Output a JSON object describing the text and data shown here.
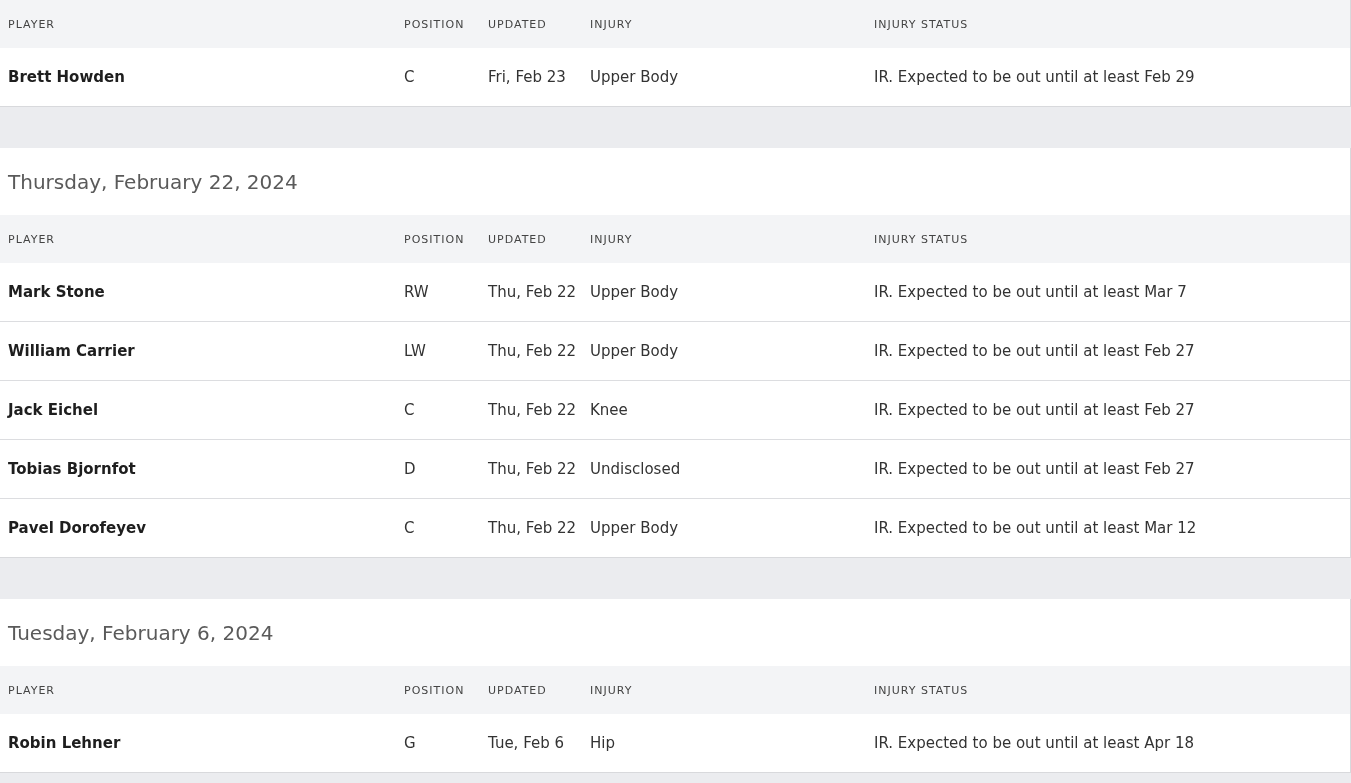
{
  "sections": [
    {
      "columns": [
        "PLAYER",
        "POSITION",
        "UPDATED",
        "INJURY",
        "INJURY STATUS"
      ],
      "rows": [
        {
          "player": "Brett Howden",
          "position": "C",
          "updated": "Fri, Feb 23",
          "injury": "Upper Body",
          "status": "IR. Expected to be out until at least Feb 29"
        }
      ]
    },
    {
      "title": "Thursday, February 22, 2024",
      "columns": [
        "PLAYER",
        "POSITION",
        "UPDATED",
        "INJURY",
        "INJURY STATUS"
      ],
      "rows": [
        {
          "player": "Mark Stone",
          "position": "RW",
          "updated": "Thu, Feb 22",
          "injury": "Upper Body",
          "status": "IR. Expected to be out until at least Mar 7"
        },
        {
          "player": "William Carrier",
          "position": "LW",
          "updated": "Thu, Feb 22",
          "injury": "Upper Body",
          "status": "IR. Expected to be out until at least Feb 27"
        },
        {
          "player": "Jack Eichel",
          "position": "C",
          "updated": "Thu, Feb 22",
          "injury": "Knee",
          "status": "IR. Expected to be out until at least Feb 27"
        },
        {
          "player": "Tobias Bjornfot",
          "position": "D",
          "updated": "Thu, Feb 22",
          "injury": "Undisclosed",
          "status": "IR. Expected to be out until at least Feb 27"
        },
        {
          "player": "Pavel Dorofeyev",
          "position": "C",
          "updated": "Thu, Feb 22",
          "injury": "Upper Body",
          "status": "IR. Expected to be out until at least Mar 12"
        }
      ]
    },
    {
      "title": "Tuesday, February 6, 2024",
      "columns": [
        "PLAYER",
        "POSITION",
        "UPDATED",
        "INJURY",
        "INJURY STATUS"
      ],
      "rows": [
        {
          "player": "Robin Lehner",
          "position": "G",
          "updated": "Tue, Feb 6",
          "injury": "Hip",
          "status": "IR. Expected to be out until at least Apr 18"
        }
      ]
    }
  ]
}
